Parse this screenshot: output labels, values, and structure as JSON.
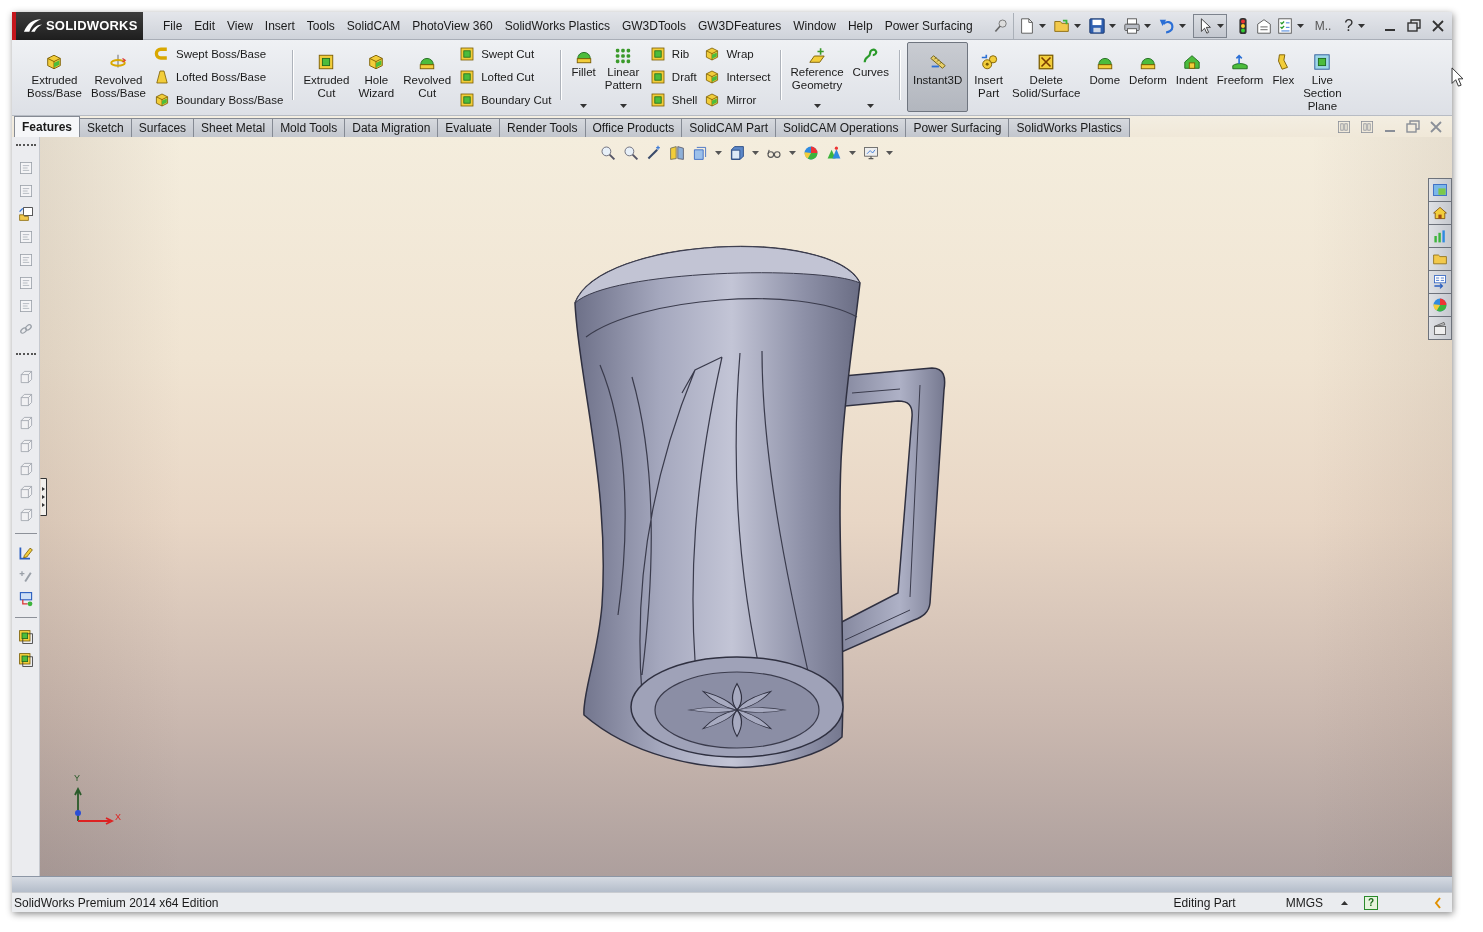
{
  "title_bar": {
    "logo": "SOLIDWORKS",
    "menu": [
      "File",
      "Edit",
      "View",
      "Insert",
      "Tools",
      "SolidCAM",
      "PhotoView 360",
      "SolidWorks Plastics",
      "GW3DTools",
      "GW3DFeatures",
      "Window",
      "Help",
      "Power Surfacing"
    ],
    "select_tool": {
      "pressed": true
    },
    "overflow_label": "M..",
    "help": "?"
  },
  "command_manager": {
    "groups": [
      {
        "items": [
          {
            "kind": "large",
            "label": "Extruded\nBoss/Base",
            "pressed": false
          },
          {
            "kind": "large",
            "label": "Revolved\nBoss/Base",
            "pressed": false
          },
          {
            "kind": "stack",
            "items": [
              "Swept Boss/Base",
              "Lofted Boss/Base",
              "Boundary Boss/Base"
            ]
          }
        ]
      },
      {
        "items": [
          {
            "kind": "large",
            "label": "Extruded\nCut",
            "pressed": false
          },
          {
            "kind": "large",
            "label": "Hole\nWizard",
            "pressed": false
          },
          {
            "kind": "large",
            "label": "Revolved\nCut",
            "pressed": false
          },
          {
            "kind": "stack",
            "items": [
              "Swept Cut",
              "Lofted Cut",
              "Boundary Cut"
            ]
          }
        ]
      },
      {
        "items": [
          {
            "kind": "split",
            "label": "Fillet",
            "pressed": false
          },
          {
            "kind": "split",
            "label": "Linear\nPattern",
            "pressed": false
          },
          {
            "kind": "stack",
            "items": [
              "Rib",
              "Draft",
              "Shell"
            ]
          },
          {
            "kind": "stack",
            "items": [
              "Wrap",
              "Intersect",
              "Mirror"
            ]
          }
        ]
      },
      {
        "items": [
          {
            "kind": "split",
            "label": "Reference\nGeometry",
            "pressed": false
          },
          {
            "kind": "split",
            "label": "Curves",
            "pressed": false
          }
        ]
      },
      {
        "items": [
          {
            "kind": "large",
            "label": "Instant3D",
            "pressed": true
          },
          {
            "kind": "large",
            "label": "Insert\nPart",
            "pressed": false
          },
          {
            "kind": "large",
            "label": "Delete\nSolid/Surface",
            "pressed": false
          },
          {
            "kind": "large",
            "label": "Dome",
            "pressed": false
          },
          {
            "kind": "large",
            "label": "Deform",
            "pressed": false
          },
          {
            "kind": "large",
            "label": "Indent",
            "pressed": false
          },
          {
            "kind": "large",
            "label": "Freeform",
            "pressed": false
          },
          {
            "kind": "large",
            "label": "Flex",
            "pressed": false
          },
          {
            "kind": "large",
            "label": "Live\nSection\nPlane",
            "pressed": false
          }
        ]
      }
    ]
  },
  "tabs": [
    {
      "label": "Features",
      "selected": true
    },
    {
      "label": "Sketch",
      "selected": false
    },
    {
      "label": "Surfaces",
      "selected": false
    },
    {
      "label": "Sheet Metal",
      "selected": false
    },
    {
      "label": "Mold Tools",
      "selected": false
    },
    {
      "label": "Data Migration",
      "selected": false
    },
    {
      "label": "Evaluate",
      "selected": false
    },
    {
      "label": "Render Tools",
      "selected": false
    },
    {
      "label": "Office Products",
      "selected": false
    },
    {
      "label": "SolidCAM Part",
      "selected": false
    },
    {
      "label": "SolidCAM Operations",
      "selected": false
    },
    {
      "label": "Power Surfacing",
      "selected": false
    },
    {
      "label": "SolidWorks Plastics",
      "selected": false
    }
  ],
  "viewport": {
    "triad": {
      "x_axis": "X",
      "y_axis": "Y"
    }
  },
  "status_bar": {
    "edition": "SolidWorks Premium 2014 x64 Edition",
    "mode": "Editing Part",
    "units": "MMGS",
    "help": "?"
  }
}
